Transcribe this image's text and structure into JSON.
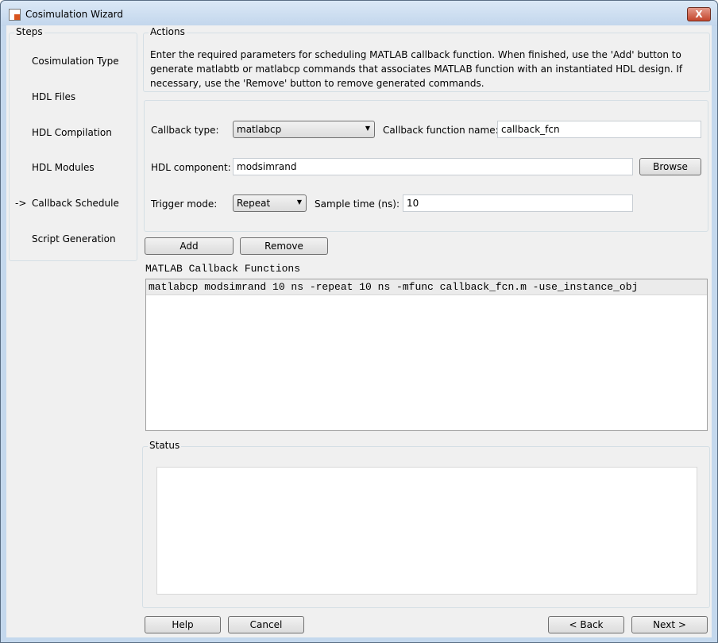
{
  "window": {
    "title": "Cosimulation Wizard",
    "close_label": "X"
  },
  "steps": {
    "title": "Steps",
    "current_marker": "->",
    "items": [
      {
        "label": "Cosimulation Type"
      },
      {
        "label": "HDL Files"
      },
      {
        "label": "HDL Compilation"
      },
      {
        "label": "HDL Modules"
      },
      {
        "label": "Callback Schedule",
        "current": true
      },
      {
        "label": "Script Generation"
      }
    ]
  },
  "actions": {
    "title": "Actions",
    "text": "Enter the required parameters for scheduling MATLAB callback function. When finished, use the 'Add' button to generate matlabtb or matlabcp commands that associates MATLAB function with an instantiated HDL design. If necessary, use the 'Remove' button to remove generated commands."
  },
  "form": {
    "callback_type_label": "Callback type:",
    "callback_type_value": "matlabcp",
    "callback_fn_label": "Callback function name:",
    "callback_fn_value": "callback_fcn",
    "hdl_component_label": "HDL component:",
    "hdl_component_value": "modsimrand",
    "browse_label": "Browse",
    "trigger_mode_label": "Trigger mode:",
    "trigger_mode_value": "Repeat",
    "sample_time_label": "Sample time (ns):",
    "sample_time_value": "10"
  },
  "add_label": "Add",
  "remove_label": "Remove",
  "callbacks": {
    "title": "MATLAB Callback Functions",
    "items": [
      "matlabcp modsimrand 10 ns -repeat 10 ns -mfunc callback_fcn.m -use_instance_obj"
    ]
  },
  "status": {
    "title": "Status",
    "text": ""
  },
  "footer": {
    "help": "Help",
    "cancel": "Cancel",
    "back": "< Back",
    "next": "Next >"
  }
}
